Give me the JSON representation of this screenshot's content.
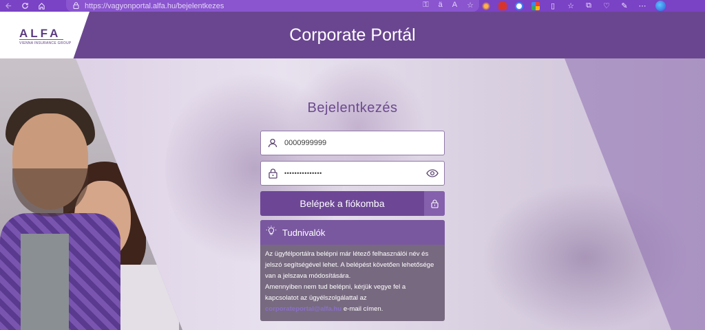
{
  "browser": {
    "url": "https://vagyonportal.alfa.hu/bejelentkezes"
  },
  "header": {
    "logo": "ALFA",
    "logo_sub": "VIENNA INSURANCE GROUP",
    "title": "Corporate Portál"
  },
  "login": {
    "title": "Bejelentkezés",
    "username_value": "0000999999",
    "password_value": "•••••••••••••••",
    "submit_label": "Belépek a fiókomba"
  },
  "info": {
    "title": "Tudnivalók",
    "paragraph1": "Az ügyfélportálra belépni már létező felhasználói név és jelszó segítségével lehet. A belépést követően lehetősége van a jelszava módosítására.",
    "paragraph2_prefix": "Amennyiben nem tud belépni, kérjük vegye fel a kapcsolatot az ügyélszolgálattal az",
    "email": "corporateportal@alfa.hu",
    "paragraph2_suffix": "e-mail címen."
  },
  "colors": {
    "header": "#6a4690",
    "accent": "#6d4796",
    "browser_bar": "#7a42c4"
  }
}
